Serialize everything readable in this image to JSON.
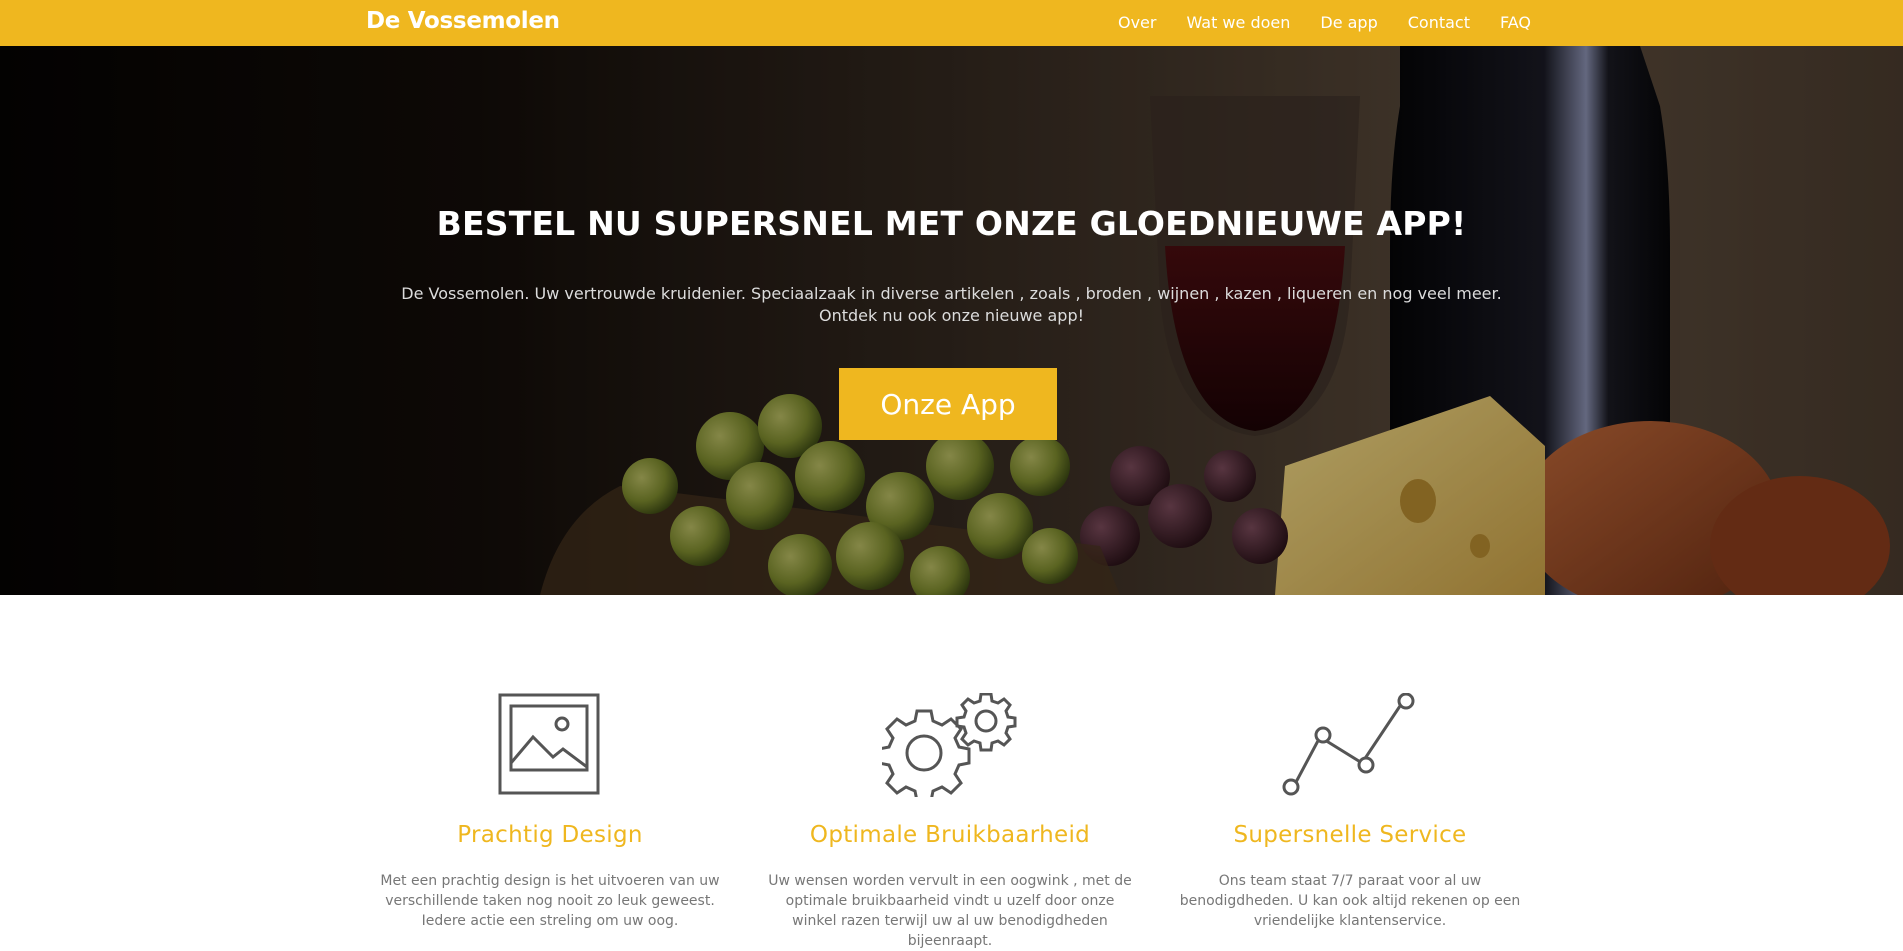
{
  "navbar": {
    "brand": "De Vossemolen",
    "links": [
      "Over",
      "Wat we doen",
      "De app",
      "Contact",
      "FAQ"
    ],
    "bg_color": "#efb71f"
  },
  "hero": {
    "title": "BESTEL NU SUPERSNEL MET ONZE GLOEDNIEUWE APP!",
    "text": "De Vossemolen. Uw vertrouwde kruidenier. Speciaalzaak in diverse artikelen , zoals , broden , wijnen , kazen , liqueren en nog veel meer. Ontdek nu ook onze nieuwe app!",
    "button_label": "Onze App",
    "background_image": "wine-grapes-cheese-bread-photo"
  },
  "features": [
    {
      "icon": "image-frame-icon",
      "title": "Prachtig Design",
      "text": "Met een prachtig design is het uitvoeren van uw verschillende taken nog nooit zo leuk geweest. Iedere actie een streling om uw oog."
    },
    {
      "icon": "gears-icon",
      "title": "Optimale Bruikbaarheid",
      "text": "Uw wensen worden vervult in een oogwink , met de optimale bruikbaarheid vindt u uzelf door onze winkel razen terwijl uw al uw benodigdheden bijeenraapt."
    },
    {
      "icon": "line-chart-icon",
      "title": "Supersnelle Service",
      "text": "Ons team staat 7/7 paraat voor al uw benodigdheden. U kan ook altijd rekenen op een vriendelijke klantenservice."
    }
  ],
  "colors": {
    "accent": "#efb71f",
    "icon_stroke": "#555555",
    "body_text": "#777777"
  }
}
